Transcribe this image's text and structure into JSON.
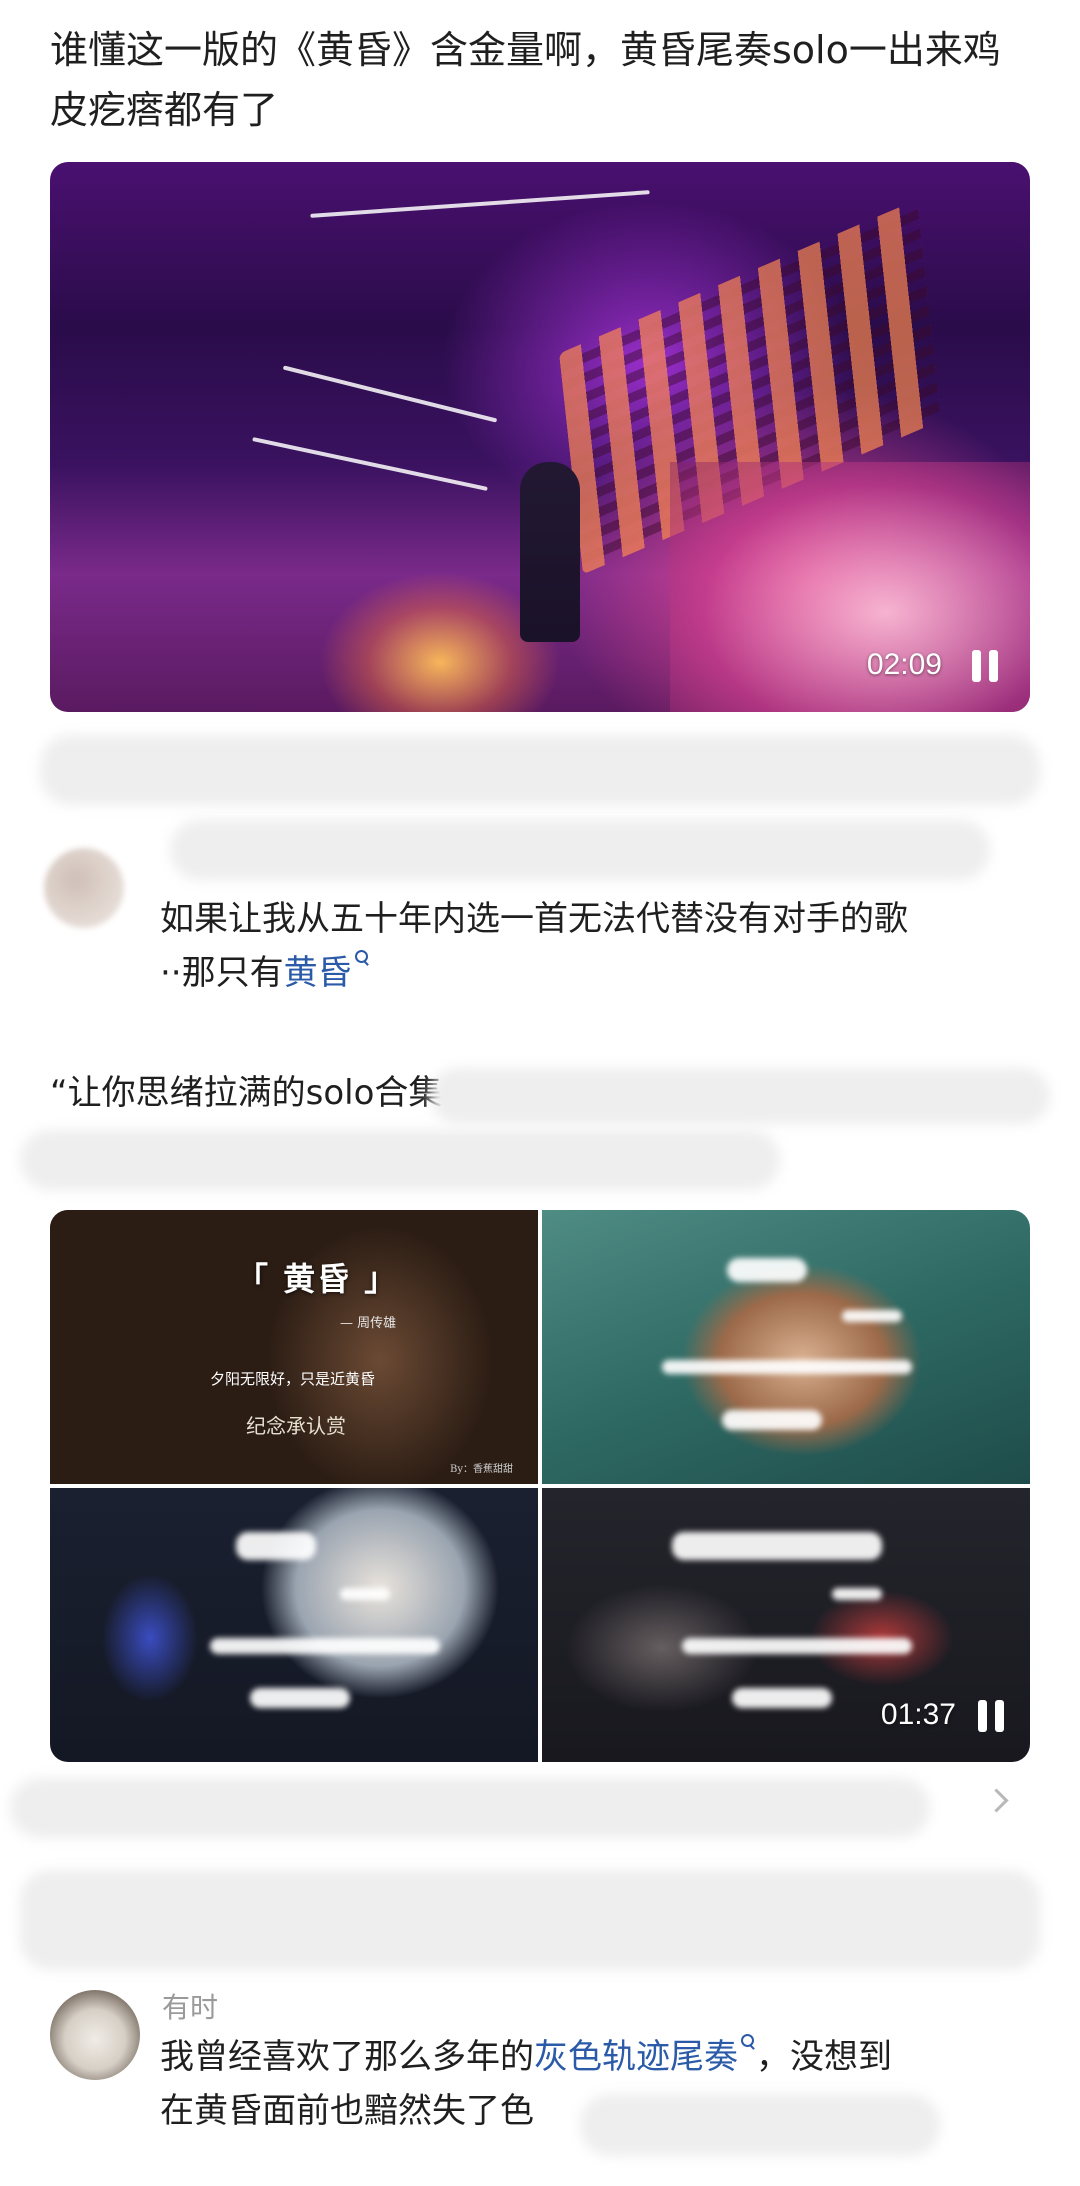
{
  "post": {
    "text_line1": "谁懂这一版的《黄昏》含金量啊，黄昏尾奏solo一出来鸡",
    "text_line2": "皮疙瘩都有了"
  },
  "video1": {
    "time": "02:09",
    "state_icon": "pause-icon"
  },
  "comment1": {
    "line1": "如果让我从五十年内选一首无法代替没有对手的歌",
    "line2_prefix": "··那只有",
    "link": "黄昏"
  },
  "section2": {
    "text": "“让你思绪拉满的solo合集"
  },
  "collage": {
    "tile1": {
      "title": "「 黄昏 」",
      "artist": "— 周传雄",
      "lyric": "夕阳无限好，只是近黄昏",
      "credit": "纪念承认赏",
      "small": "By：香蕉甜甜"
    },
    "video_time": "01:37",
    "state_icon": "pause-icon",
    "titles_obscured": [
      "「 」",
      "「 」",
      "「 」"
    ]
  },
  "more_chevron": "chevron-right-icon",
  "comment2": {
    "username": "有时",
    "line1_prefix": "我曾经喜欢了那么多年的",
    "link": "灰色轨迹尾奏",
    "line1_suffix": "，没想到",
    "line2": "在黄昏面前也黯然失了色"
  },
  "colors": {
    "link": "#2a5aa8",
    "text": "#1f1f1f",
    "muted": "#9a9a9a"
  }
}
